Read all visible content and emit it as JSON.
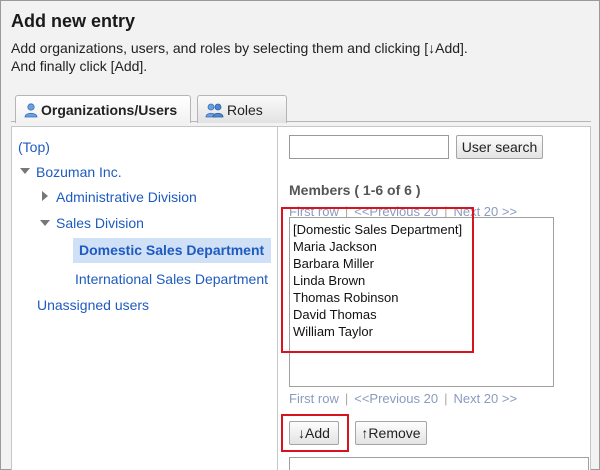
{
  "header": {
    "title": "Add new entry",
    "desc_line1": "Add organizations, users, and roles by selecting them and clicking [↓Add].",
    "desc_line2": "And finally click [Add]."
  },
  "tabs": [
    {
      "label": "Organizations/Users",
      "icon": "user-icon",
      "active": true
    },
    {
      "label": "Roles",
      "icon": "users-icon",
      "active": false
    }
  ],
  "tree": {
    "top": "(Top)",
    "company": "Bozuman Inc.",
    "admin_division": "Administrative Division",
    "sales_division": "Sales Division",
    "domestic": "Domestic Sales Department",
    "international": "International Sales Department",
    "unassigned": "Unassigned users"
  },
  "search": {
    "value": "",
    "button": "User search"
  },
  "members": {
    "title": "Members ( 1-6 of 6 )",
    "pager": {
      "first": "First row",
      "sep": "|",
      "prev": "<<Previous 20",
      "next": "Next 20 >>"
    },
    "items": [
      "[Domestic Sales Department]",
      "Maria Jackson",
      "Barbara Miller",
      "Linda Brown",
      "Thomas Robinson",
      "David Thomas",
      "William Taylor"
    ]
  },
  "actions": {
    "add": "↓Add",
    "remove": "↑Remove"
  },
  "colors": {
    "link": "#1f5bbf",
    "highlight": "#d9131d",
    "selected_bg": "#cfe0f7"
  }
}
